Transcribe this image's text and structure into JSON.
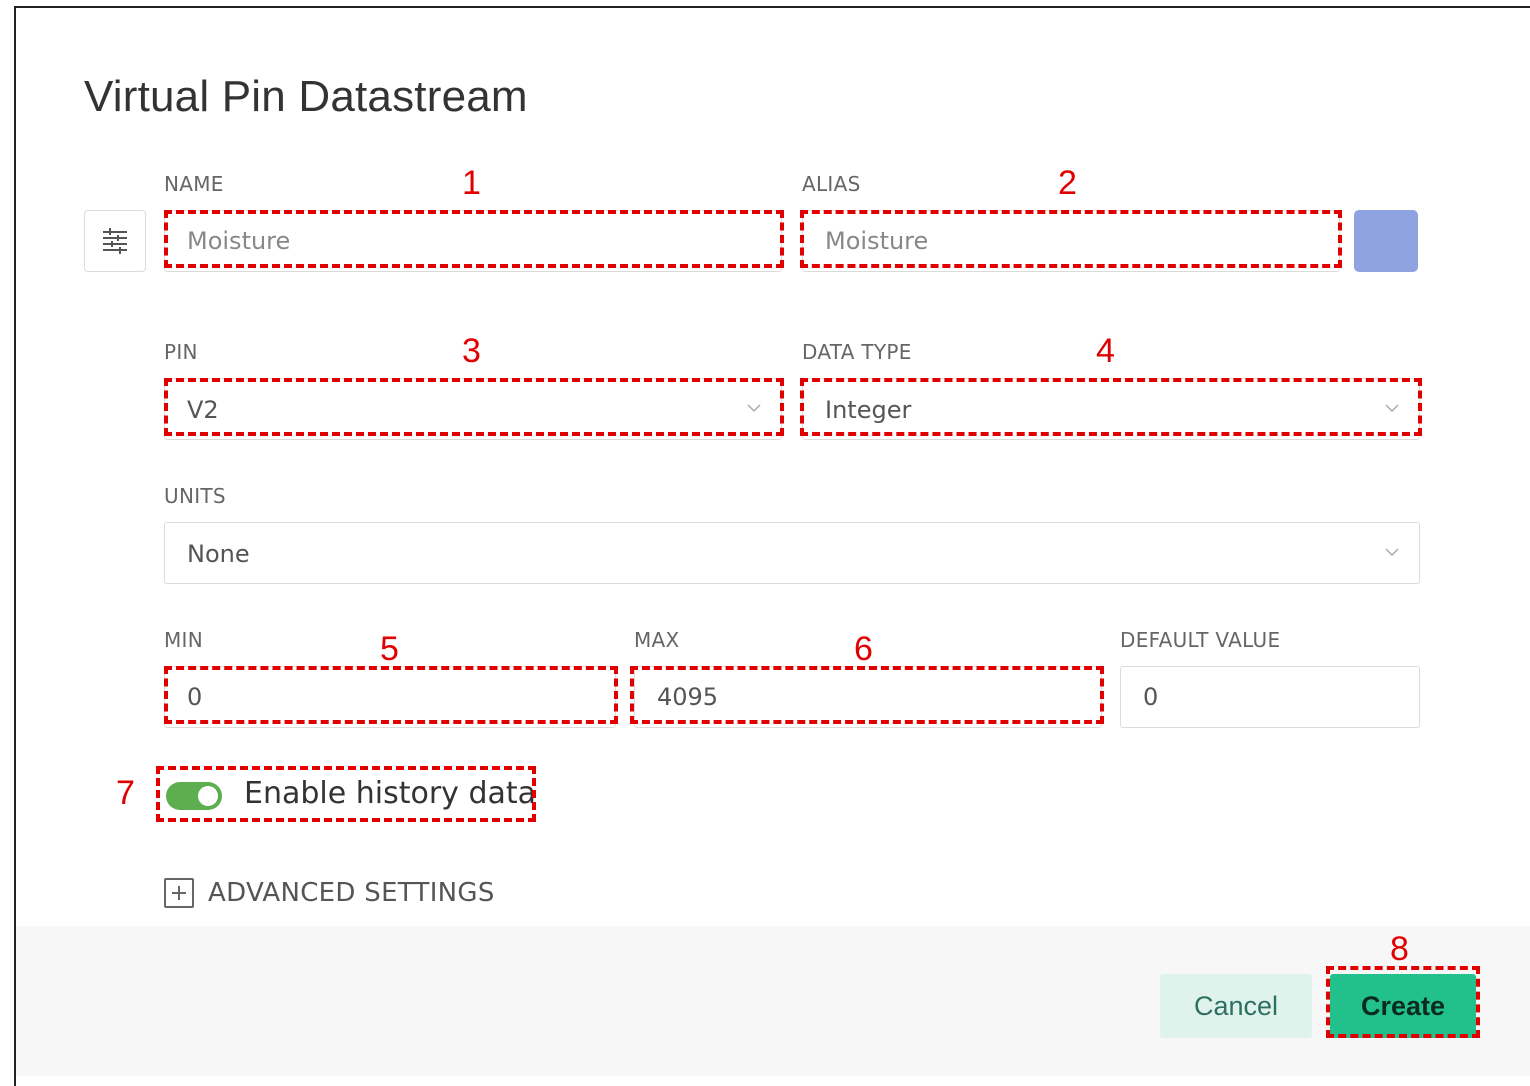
{
  "dialog": {
    "title": "Virtual Pin Datastream"
  },
  "fields": {
    "name": {
      "label": "NAME",
      "placeholder": "Moisture"
    },
    "alias": {
      "label": "ALIAS",
      "placeholder": "Moisture"
    },
    "pin": {
      "label": "PIN",
      "value": "V2"
    },
    "data_type": {
      "label": "DATA TYPE",
      "value": "Integer"
    },
    "units": {
      "label": "UNITS",
      "value": "None"
    },
    "min": {
      "label": "MIN",
      "value": "0"
    },
    "max": {
      "label": "MAX",
      "value": "4095"
    },
    "default_value": {
      "label": "DEFAULT VALUE",
      "value": "0"
    }
  },
  "color_swatch": "#8fa3e0",
  "history": {
    "label": "Enable history data",
    "enabled": true
  },
  "advanced": {
    "label": "ADVANCED SETTINGS"
  },
  "buttons": {
    "cancel": "Cancel",
    "create": "Create"
  },
  "annotations": {
    "n1": "1",
    "n2": "2",
    "n3": "3",
    "n4": "4",
    "n5": "5",
    "n6": "6",
    "n7": "7",
    "n8": "8"
  }
}
